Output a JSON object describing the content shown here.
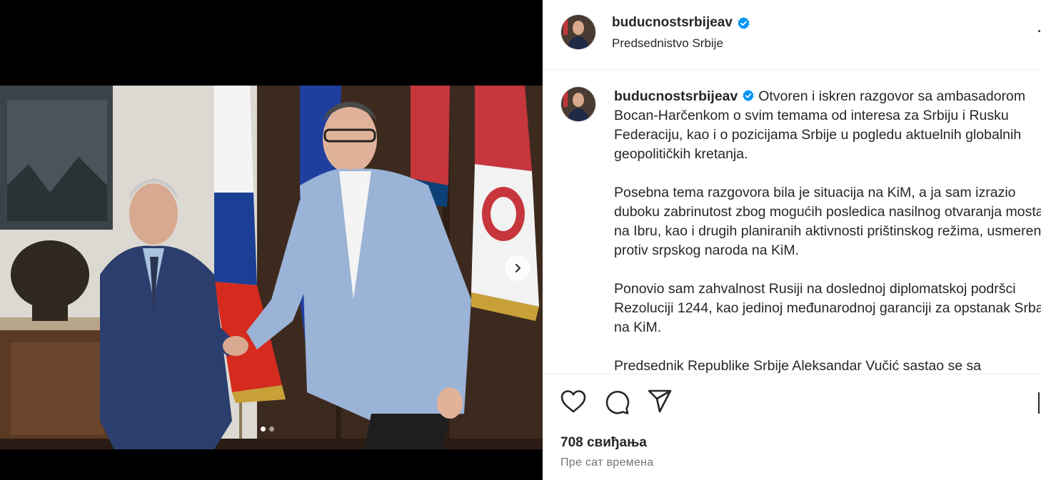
{
  "post": {
    "username": "buducnostsrbijeav",
    "location": "Predsednistvo Srbije",
    "caption_paragraphs": [
      " Otvoren i iskren razgovor sa ambasadorom Bocan-Harčenkom o svim temama od interesa za Srbiju i Rusku Federaciju, kao i o pozicijama Srbije u pogledu aktuelnih globalnih geopolitičkih kretanja.",
      "Posebna tema razgovora bila je situacija na KiM, a ja sam izrazio duboku zabrinutost zbog mogućih posledica nasilnog otvaranja mosta na Ibru, kao i drugih planiranih aktivnosti prištinskog režima, usmerenih protiv srpskog naroda na KiM.",
      "Ponovio sam zahvalnost Rusiji na doslednoj diplomatskoj podršci Rezoluciji 1244, kao jedinoj međunarodnoj garanciji za opstanak Srba na KiM.",
      "Predsednik Republike Srbije Aleksandar Vučić sastao se sa"
    ],
    "likes": "708 свиђања",
    "time": "Пре сат времена",
    "more_glyph": "·"
  },
  "carousel": {
    "slide_count": 2,
    "active_index": 0
  },
  "icons": {
    "verified": "verified-badge-icon",
    "like": "heart-icon",
    "comment": "comment-icon",
    "share": "share-icon",
    "next": "chevron-right-icon"
  },
  "colors": {
    "verified": "#0095f6",
    "text": "#262626",
    "muted": "#737373"
  }
}
